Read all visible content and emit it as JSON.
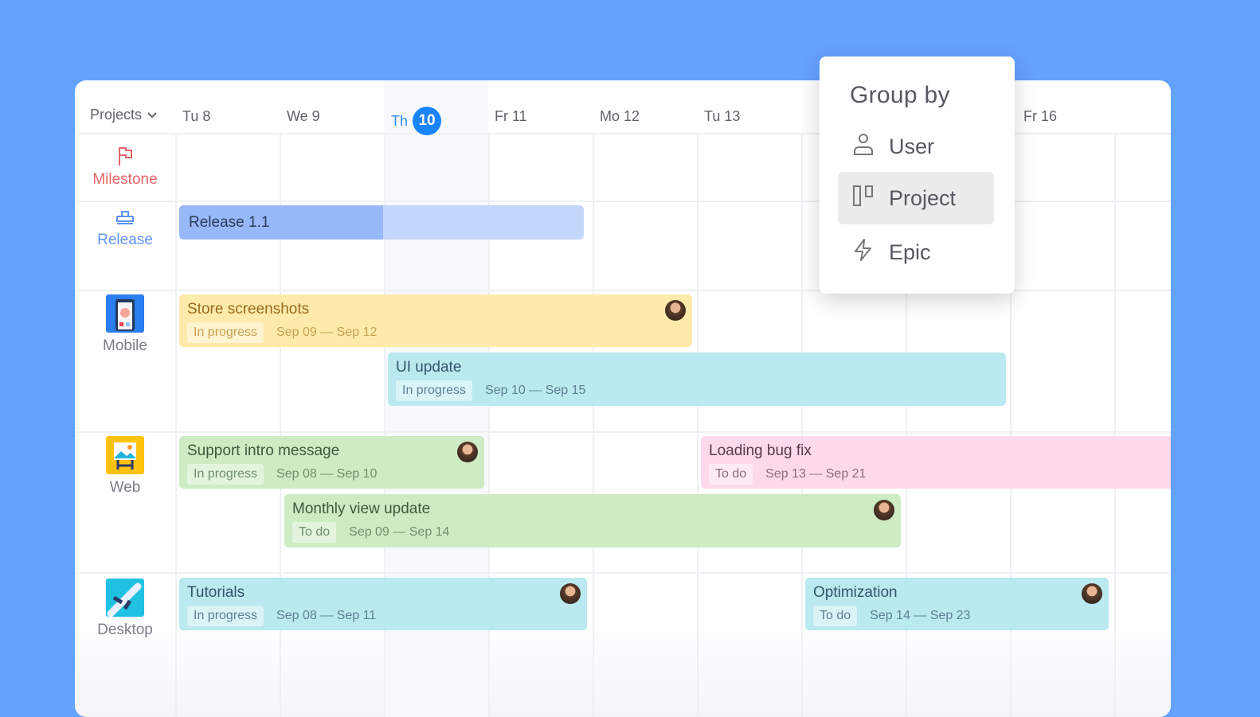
{
  "header": {
    "projects_label": "Projects",
    "days": [
      "Tu 8",
      "We 9",
      "Fr 11",
      "Mo 12",
      "Tu 13",
      "Fr 16"
    ],
    "today": {
      "weekday": "Th",
      "day": "10"
    }
  },
  "rows": [
    {
      "label": "Milestone",
      "icon": "flag-icon",
      "color": "#e5646a"
    },
    {
      "label": "Release",
      "icon": "ship-icon",
      "color": "#5f93f5"
    },
    {
      "label": "Mobile",
      "icon": "mobile-app-icon"
    },
    {
      "label": "Web",
      "icon": "web-app-icon"
    },
    {
      "label": "Desktop",
      "icon": "desktop-app-icon"
    }
  ],
  "release": {
    "title": "Release 1.1"
  },
  "tasks": [
    {
      "title": "Store screenshots",
      "status": "In progress",
      "dates": "Sep 09 — Sep 12",
      "bg": "#feebab",
      "fg": "#9a6a1c",
      "sub": "#c8a051",
      "avatar": true
    },
    {
      "title": "UI update",
      "status": "In progress",
      "dates": "Sep 10 — Sep 15",
      "bg": "#bae9f0",
      "fg": "#34546b",
      "sub": "#5f8095",
      "avatar": false
    },
    {
      "title": "Support intro message",
      "status": "In progress",
      "dates": "Sep 08 — Sep 10",
      "bg": "#cdecc4",
      "fg": "#3c5a3c",
      "sub": "#6f8f6c",
      "avatar": true
    },
    {
      "title": "Loading bug fix",
      "status": "To do",
      "dates": "Sep 13 — Sep 21",
      "bg": "#fcd9eb",
      "fg": "#5a3a4c",
      "sub": "#8e6b7e",
      "avatar": false
    },
    {
      "title": "Monthly view update",
      "status": "To do",
      "dates": "Sep 09 — Sep 14",
      "bg": "#cdecc4",
      "fg": "#3c5a3c",
      "sub": "#6f8f6c",
      "avatar": true
    },
    {
      "title": "Tutorials",
      "status": "In progress",
      "dates": "Sep 08 — Sep 11",
      "bg": "#bae9f0",
      "fg": "#34546b",
      "sub": "#5f8095",
      "avatar": true
    },
    {
      "title": "Optimization",
      "status": "To do",
      "dates": "Sep 14 — Sep 23",
      "bg": "#bae9f0",
      "fg": "#34546b",
      "sub": "#5f8095",
      "avatar": true
    }
  ],
  "group_by": {
    "title": "Group by",
    "options": [
      {
        "label": "User",
        "icon": "user-icon"
      },
      {
        "label": "Project",
        "icon": "board-icon",
        "selected": true
      },
      {
        "label": "Epic",
        "icon": "lightning-icon"
      }
    ]
  }
}
